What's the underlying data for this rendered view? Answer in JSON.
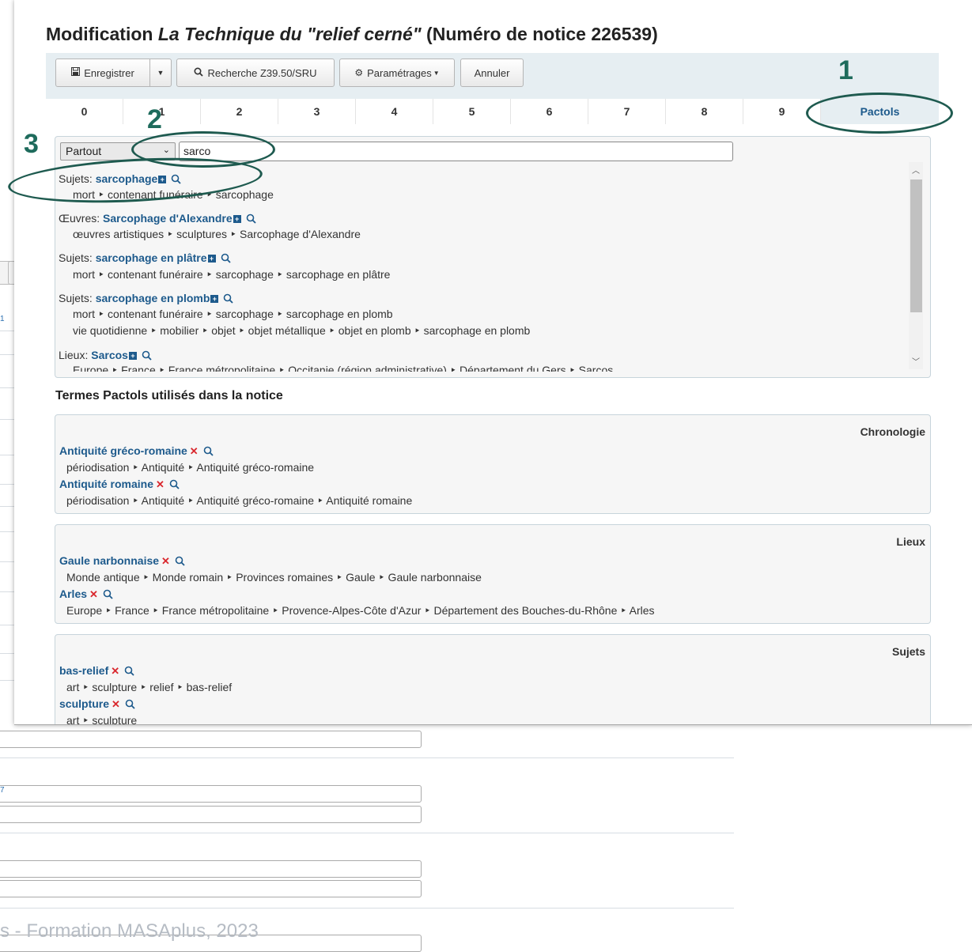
{
  "title": {
    "prefix": "Modification ",
    "record_title": "La Technique du \"relief cerné\"",
    "suffix": " (Numéro de notice 226539)"
  },
  "toolbar": {
    "save_label": "Enregistrer",
    "search_label": "Recherche Z39.50/SRU",
    "settings_label": "Paramétrages",
    "cancel_label": "Annuler"
  },
  "tabs": [
    "0",
    "1",
    "2",
    "3",
    "4",
    "5",
    "6",
    "7",
    "8",
    "9",
    "Pactols"
  ],
  "search": {
    "scope": "Partout",
    "query": "sarco"
  },
  "results": [
    {
      "category": "Sujets:",
      "term": "sarcophage",
      "paths": [
        "mort ‣ contenant funéraire ‣ sarcophage"
      ]
    },
    {
      "category": "Œuvres:",
      "term": "Sarcophage d'Alexandre",
      "paths": [
        "œuvres artistiques ‣ sculptures ‣ Sarcophage d'Alexandre"
      ]
    },
    {
      "category": "Sujets:",
      "term": "sarcophage en plâtre",
      "paths": [
        "mort ‣ contenant funéraire ‣ sarcophage ‣ sarcophage en plâtre"
      ]
    },
    {
      "category": "Sujets:",
      "term": "sarcophage en plomb",
      "paths": [
        "mort ‣ contenant funéraire ‣ sarcophage ‣ sarcophage en plomb",
        "vie quotidienne ‣ mobilier ‣ objet ‣ objet métallique ‣ objet en plomb ‣ sarcophage en plomb"
      ]
    },
    {
      "category": "Lieux:",
      "term": "Sarcos",
      "paths": [
        "Europe ‣ France ‣ France métropolitaine ‣ Occitanie (région administrative) ‣ Département du Gers ‣ Sarcos"
      ]
    }
  ],
  "used_terms_title": "Termes Pactols utilisés dans la notice",
  "groups": [
    {
      "label": "Chronologie",
      "terms": [
        {
          "term": "Antiquité gréco-romaine",
          "path": "périodisation ‣ Antiquité ‣ Antiquité gréco-romaine"
        },
        {
          "term": "Antiquité romaine",
          "path": "périodisation ‣ Antiquité ‣ Antiquité gréco-romaine ‣ Antiquité romaine"
        }
      ]
    },
    {
      "label": "Lieux",
      "terms": [
        {
          "term": "Gaule narbonnaise",
          "path": "Monde antique ‣ Monde romain ‣ Provinces romaines ‣ Gaule ‣ Gaule narbonnaise"
        },
        {
          "term": "Arles",
          "path": "Europe ‣ France ‣ France métropolitaine ‣ Provence-Alpes-Côte d'Azur ‣ Département des Bouches-du-Rhône ‣ Arles"
        }
      ]
    },
    {
      "label": "Sujets",
      "terms": [
        {
          "term": "bas-relief",
          "path": "art ‣ sculpture ‣ relief ‣ bas-relief"
        },
        {
          "term": "sculpture",
          "path": "art ‣ sculpture"
        }
      ]
    }
  ],
  "annotations": [
    "1",
    "2",
    "3"
  ],
  "background": {
    "tab_fragment": "1",
    "footer": "s - Formation MASAplus, 2023"
  },
  "colors": {
    "accent": "#1d5a8c",
    "annotation": "#1e6b5c",
    "delete": "#d9272d",
    "toolbar_bg": "#e6eef2"
  },
  "icons": {
    "save": "floppy-icon",
    "search": "magnifier-icon",
    "settings": "gear-icon",
    "add": "plus-square-icon",
    "remove": "cross-icon"
  }
}
